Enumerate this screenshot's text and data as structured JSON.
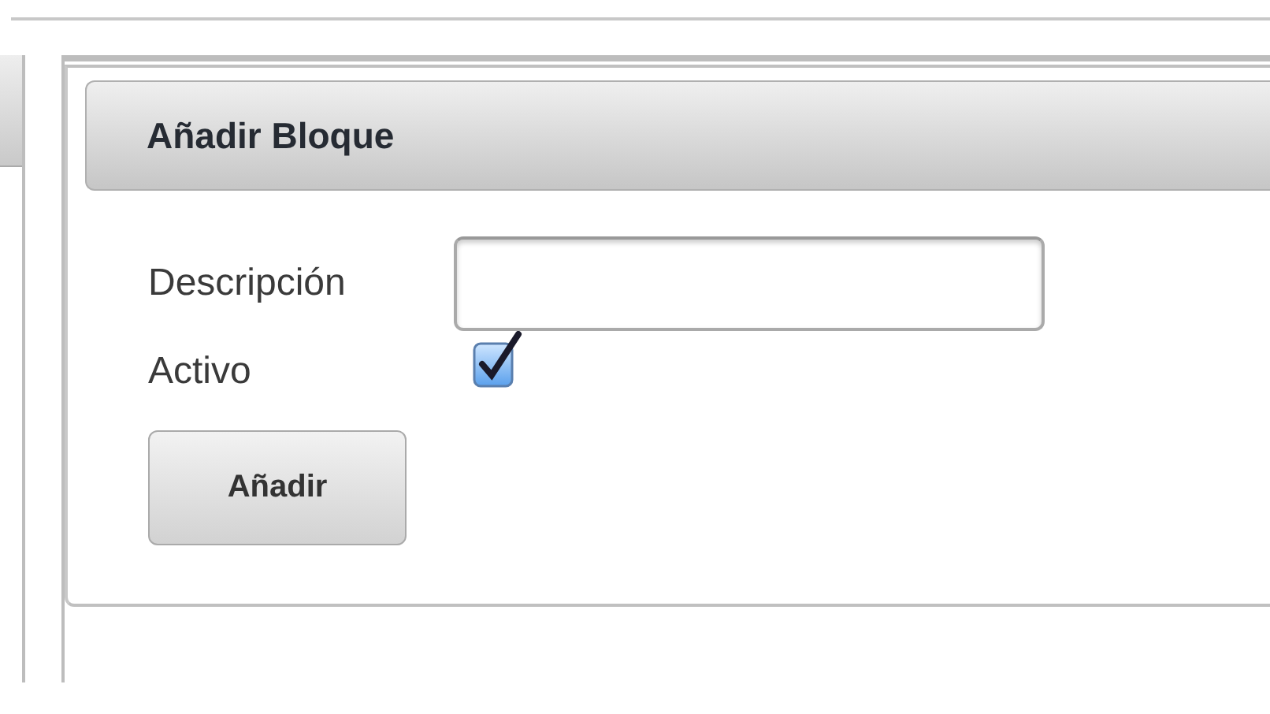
{
  "panel": {
    "title": "Añadir Bloque"
  },
  "form": {
    "description": {
      "label": "Descripción"
    },
    "active": {
      "label": "Activo",
      "checked": true
    },
    "submit": "Añadir"
  }
}
